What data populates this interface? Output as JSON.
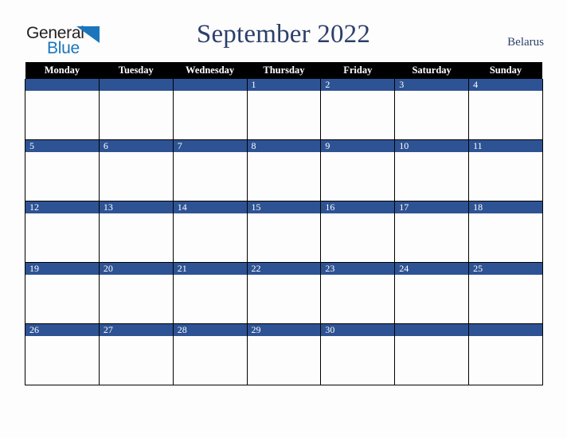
{
  "brand": {
    "line1": "General",
    "line2": "Blue",
    "triangle_color": "#1b75bc",
    "line1_color": "#231f20",
    "line2_color": "#1b75bc"
  },
  "header": {
    "title": "September 2022",
    "country": "Belarus",
    "title_color": "#2c3f6b"
  },
  "calendar": {
    "month": "September",
    "year": "2022",
    "accent_color": "#2e5394",
    "header_bg": "#000000",
    "header_fg": "#ffffff",
    "weekday_headers": [
      "Monday",
      "Tuesday",
      "Wednesday",
      "Thursday",
      "Friday",
      "Saturday",
      "Sunday"
    ],
    "weeks": [
      [
        "",
        "",
        "",
        "1",
        "2",
        "3",
        "4"
      ],
      [
        "5",
        "6",
        "7",
        "8",
        "9",
        "10",
        "11"
      ],
      [
        "12",
        "13",
        "14",
        "15",
        "16",
        "17",
        "18"
      ],
      [
        "19",
        "20",
        "21",
        "22",
        "23",
        "24",
        "25"
      ],
      [
        "26",
        "27",
        "28",
        "29",
        "30",
        "",
        ""
      ]
    ]
  }
}
